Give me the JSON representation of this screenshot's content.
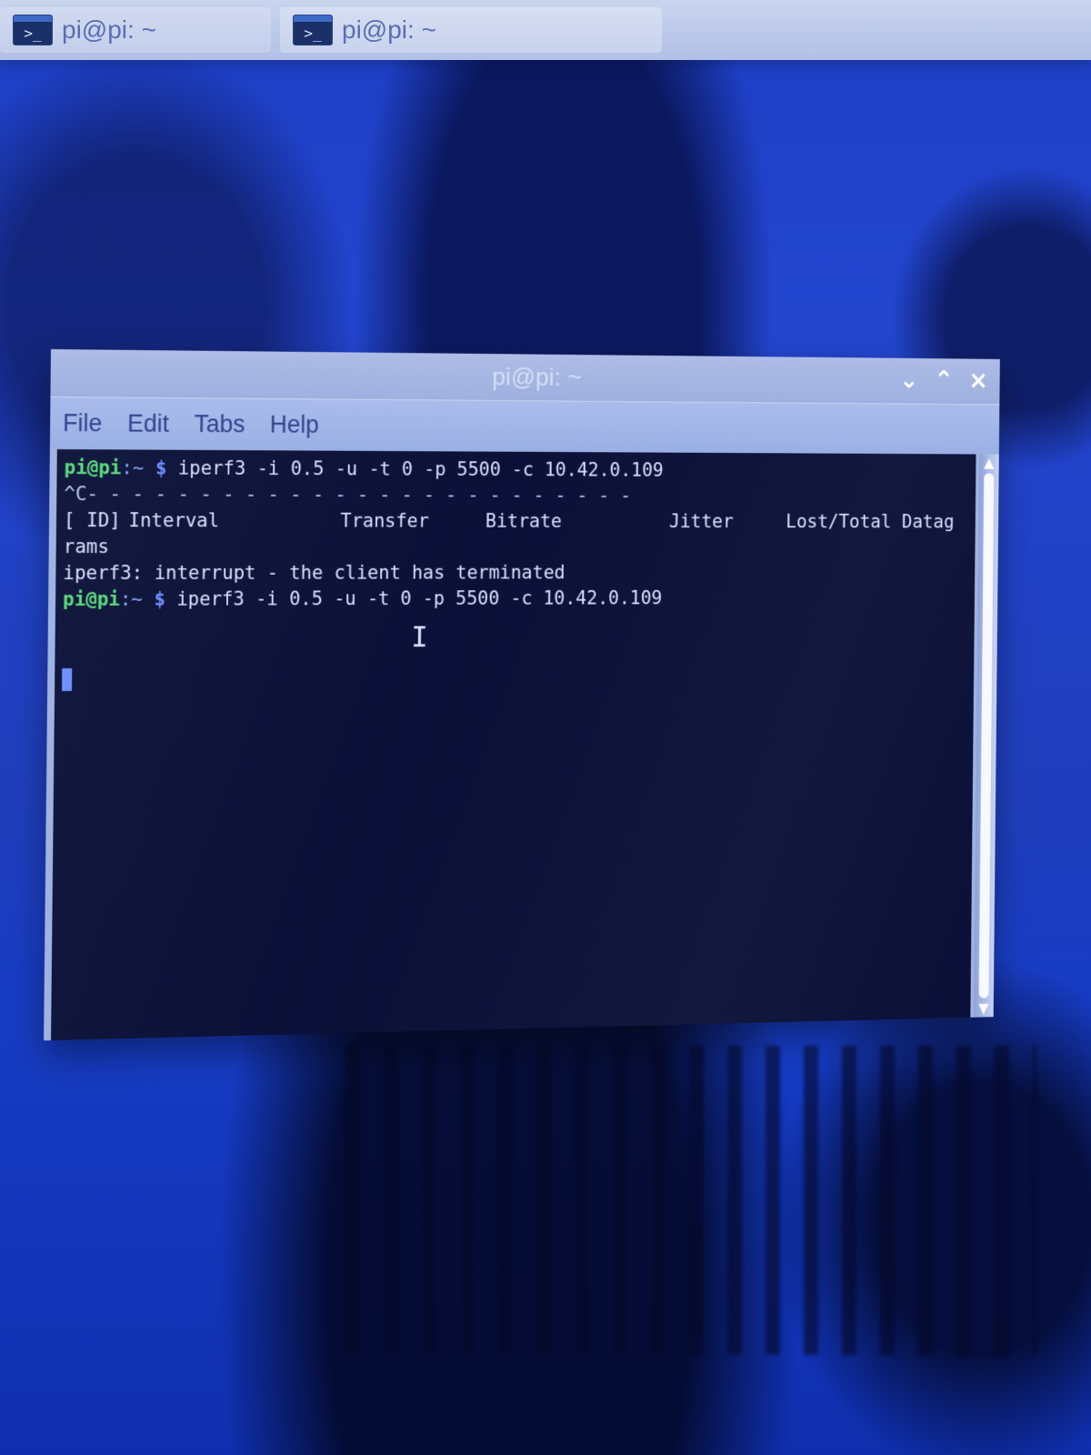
{
  "taskbar": {
    "items": [
      {
        "label": "pi@pi: ~",
        "icon": "terminal-icon"
      },
      {
        "label": "pi@pi: ~",
        "icon": "terminal-icon"
      }
    ]
  },
  "window": {
    "title": "pi@pi: ~",
    "controls": {
      "minimize_icon": "chevron-down-icon",
      "maximize_icon": "chevron-up-icon",
      "close_icon": "close-icon"
    }
  },
  "menu": {
    "items": [
      "File",
      "Edit",
      "Tabs",
      "Help"
    ]
  },
  "terminal": {
    "prompt_user": "pi@pi",
    "prompt_dir": ":~",
    "prompt_symbol": "$",
    "command_1": " iperf3 -i 0.5 -u -t 0 -p 5500 -c 10.42.0.109",
    "interrupt_line": "^C- - - - - - - - - - - - - - - - - - - - - - - - -",
    "header": {
      "id": "[ ID]",
      "interval": "Interval",
      "transfer": "Transfer",
      "bitrate": "Bitrate",
      "jitter": "Jitter",
      "lost": "Lost/Total Datag"
    },
    "wrapped_header": "rams",
    "message": "iperf3: interrupt - the client has terminated",
    "command_2": " iperf3 -i 0.5 -u -t 0 -p 5500 -c 10.42.0.109",
    "text_cursor_icon": "text-cursor-icon"
  }
}
